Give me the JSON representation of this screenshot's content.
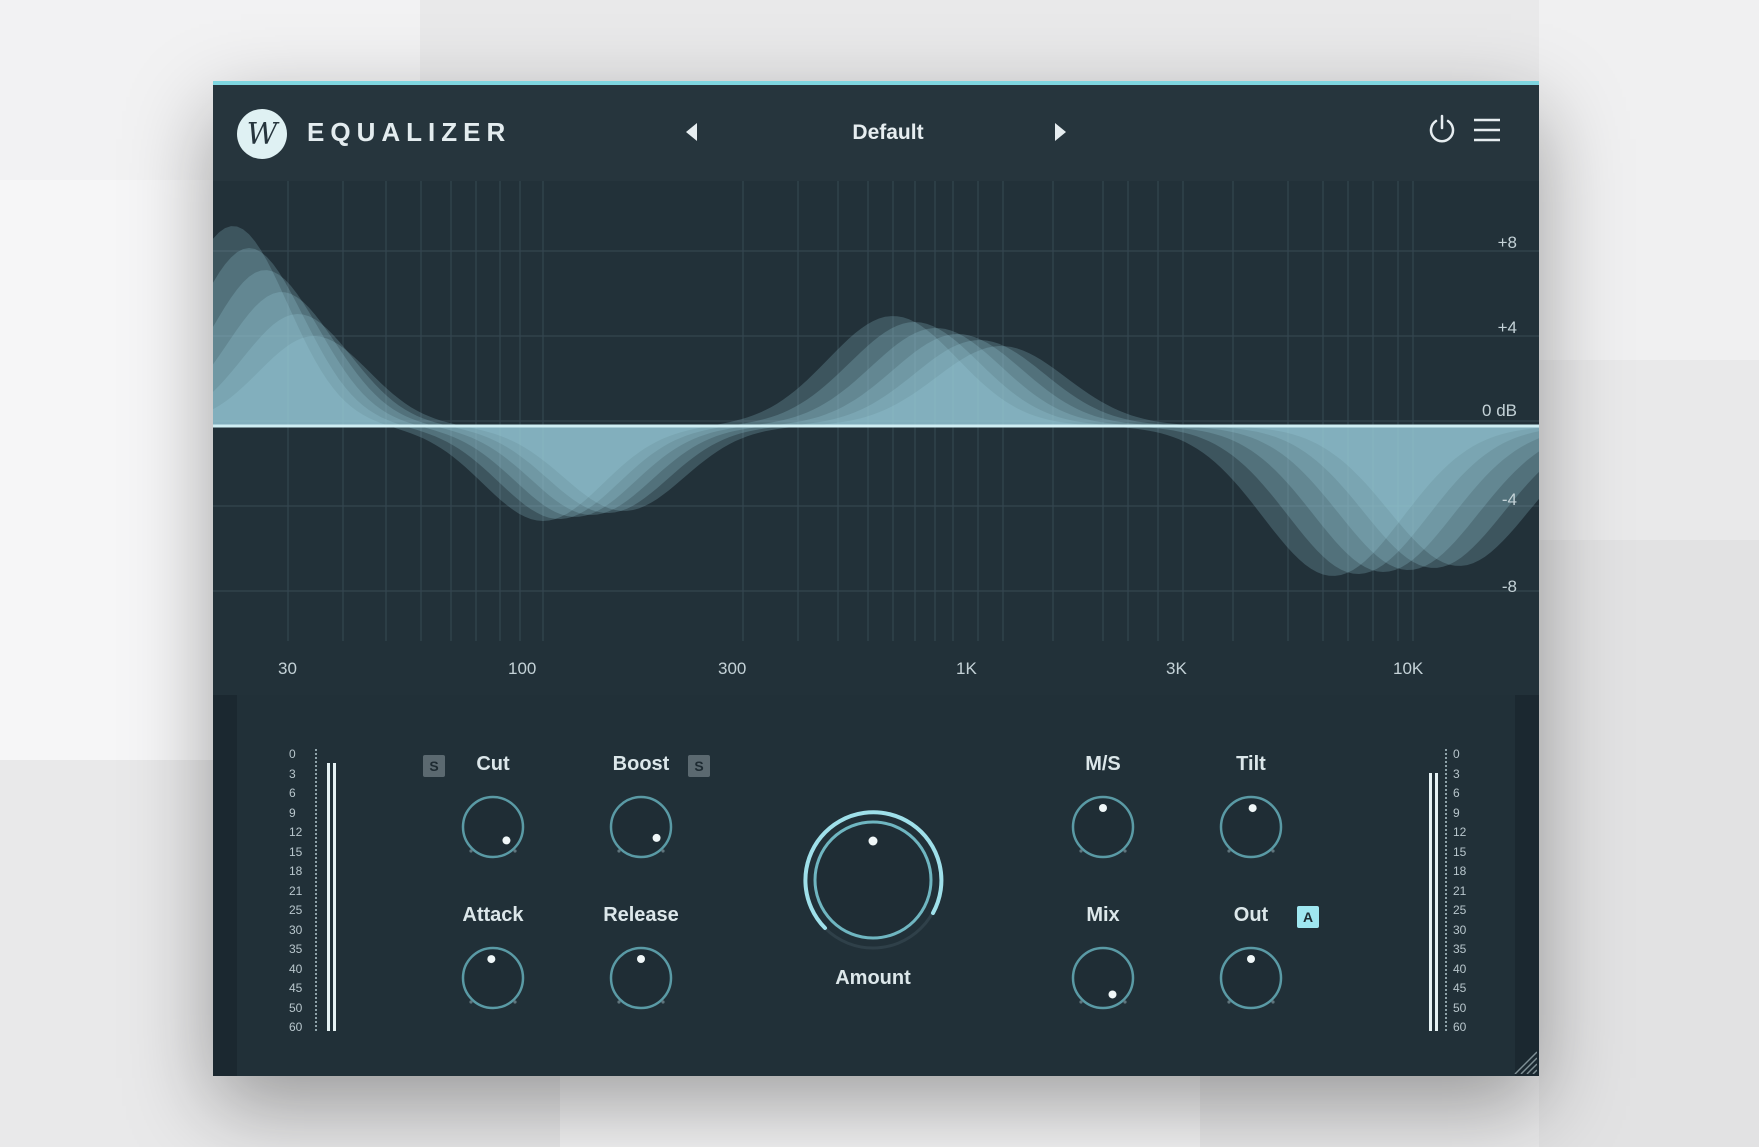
{
  "app": {
    "title": "EQUALIZER",
    "logo_letter": "W"
  },
  "header": {
    "preset": "Default"
  },
  "colors": {
    "accent": "#7fd6e0",
    "panel": "#1d2a31",
    "graph": "#223139",
    "curve": "#9fd8e3"
  },
  "graph": {
    "db_labels": [
      "+8",
      "+4",
      "0 dB",
      "-4",
      "-8"
    ],
    "freq_labels": [
      "30",
      "100",
      "300",
      "1K",
      "3K",
      "10K"
    ]
  },
  "meters": {
    "left_ticks": [
      "0",
      "3",
      "6",
      "9",
      "12",
      "15",
      "18",
      "21",
      "25",
      "30",
      "35",
      "40",
      "45",
      "50",
      "60"
    ],
    "right_ticks": [
      "0",
      "3",
      "6",
      "9",
      "12",
      "15",
      "18",
      "21",
      "25",
      "30",
      "35",
      "40",
      "45",
      "50",
      "60"
    ]
  },
  "controls": {
    "cut": {
      "label": "Cut",
      "badge": "S"
    },
    "boost": {
      "label": "Boost",
      "badge": "S"
    },
    "attack": {
      "label": "Attack"
    },
    "release": {
      "label": "Release"
    },
    "amount": {
      "label": "Amount"
    },
    "ms": {
      "label": "M/S"
    },
    "tilt": {
      "label": "Tilt"
    },
    "mix": {
      "label": "Mix"
    },
    "out": {
      "label": "Out",
      "badge": "A"
    }
  }
}
